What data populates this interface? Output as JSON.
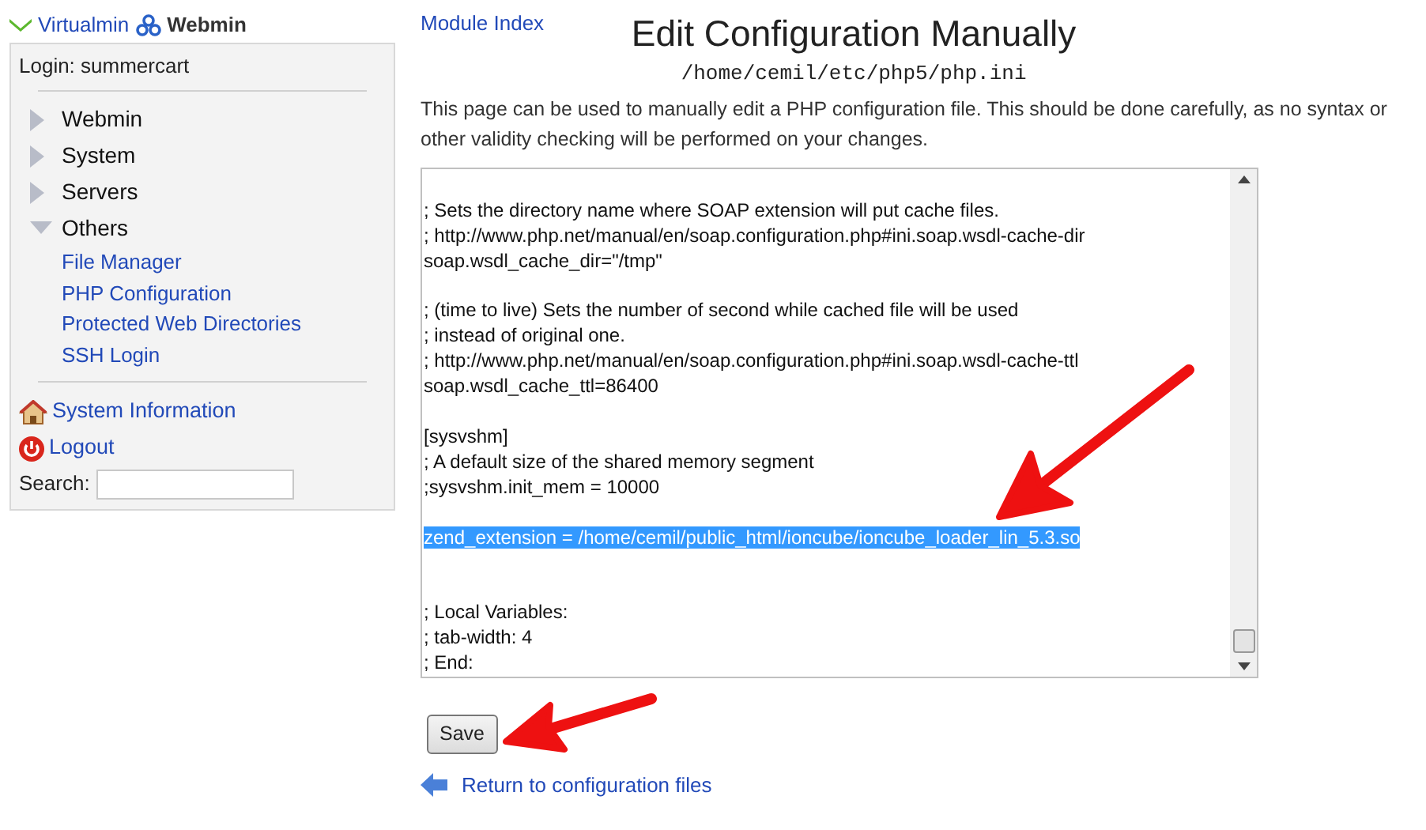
{
  "header": {
    "virtualmin": "Virtualmin",
    "webmin": "Webmin"
  },
  "sidebar": {
    "login": "Login: summercart",
    "categories": [
      {
        "label": "Webmin",
        "expanded": false
      },
      {
        "label": "System",
        "expanded": false
      },
      {
        "label": "Servers",
        "expanded": false
      },
      {
        "label": "Others",
        "expanded": true,
        "children": [
          {
            "label": "File Manager"
          },
          {
            "label": "PHP Configuration"
          },
          {
            "label": "Protected Web Directories"
          },
          {
            "label": "SSH Login"
          }
        ]
      }
    ],
    "links": [
      {
        "kind": "home",
        "label": "System Information"
      },
      {
        "kind": "logout",
        "label": "Logout"
      }
    ],
    "search": {
      "label": "Search:"
    }
  },
  "module_index": "Module Index",
  "title": "Edit Configuration Manually",
  "file_path": "/home/cemil/etc/php5/php.ini",
  "description": "This page can be used to manually edit a PHP configuration file. This should be done carefully, as no syntax or other validity checking will be performed on your changes.",
  "editor_lines": [
    {
      "kind": "text",
      "text": "; Sets the directory name where SOAP extension will put cache files."
    },
    {
      "kind": "text",
      "text": "; http://www.php.net/manual/en/soap.configuration.php#ini.soap.wsdl-cache-dir"
    },
    {
      "kind": "text",
      "text": "soap.wsdl_cache_dir=\"/tmp\""
    },
    {
      "kind": "blank"
    },
    {
      "kind": "text",
      "text": "; (time to live) Sets the number of second while cached file will be used"
    },
    {
      "kind": "text",
      "text": "; instead of original one."
    },
    {
      "kind": "text",
      "text": "; http://www.php.net/manual/en/soap.configuration.php#ini.soap.wsdl-cache-ttl"
    },
    {
      "kind": "text",
      "text": "soap.wsdl_cache_ttl=86400"
    },
    {
      "kind": "blank"
    },
    {
      "kind": "text",
      "text": "[sysvshm]"
    },
    {
      "kind": "text",
      "text": "; A default size of the shared memory segment"
    },
    {
      "kind": "text",
      "text": ";sysvshm.init_mem = 10000"
    },
    {
      "kind": "blank"
    },
    {
      "kind": "highlighted",
      "text": "zend_extension = /home/cemil/public_html/ioncube/ioncube_loader_lin_5.3.so"
    },
    {
      "kind": "blank"
    },
    {
      "kind": "blank"
    },
    {
      "kind": "text",
      "text": "; Local Variables:"
    },
    {
      "kind": "text",
      "text": "; tab-width: 4"
    },
    {
      "kind": "text",
      "text": "; End:"
    }
  ],
  "save_button": "Save",
  "return_link": "Return to configuration files"
}
